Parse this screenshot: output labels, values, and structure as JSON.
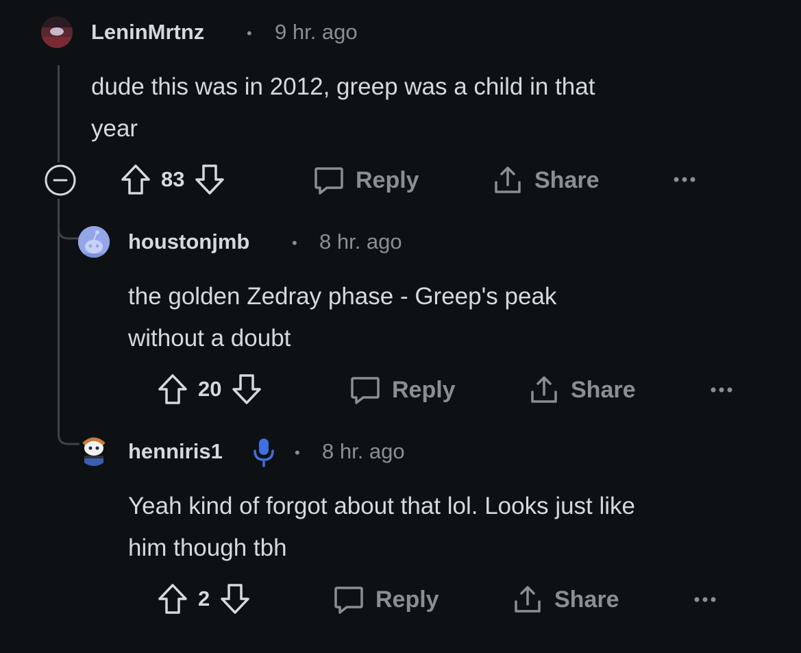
{
  "comments": [
    {
      "username": "LeninMrtnz",
      "time": "9 hr. ago",
      "body_line1": "dude this was in 2012, greep was a child in that",
      "body_line2": "year",
      "votes": "83",
      "reply_label": "Reply",
      "share_label": "Share"
    },
    {
      "username": "houstonjmb",
      "time": "8 hr. ago",
      "body_line1": "the golden Zedray phase - Greep's peak",
      "body_line2": "without a doubt",
      "votes": "20",
      "reply_label": "Reply",
      "share_label": "Share"
    },
    {
      "username": "henniris1",
      "time": "8 hr. ago",
      "body_line1": "Yeah kind of forgot about that lol. Looks just like",
      "body_line2": "him though tbh",
      "votes": "2",
      "reply_label": "Reply",
      "share_label": "Share"
    }
  ],
  "separator": "•",
  "icons": {
    "collapse": "minus-circle-icon",
    "upvote": "arrow-up-icon",
    "downvote": "arrow-down-icon",
    "reply": "speech-bubble-icon",
    "share": "share-icon",
    "more": "ellipsis-icon",
    "flair": "microphone-icon"
  },
  "colors": {
    "background": "#0e1113",
    "text": "#d7dadc",
    "muted": "#8a8f93",
    "thread_line": "#3f4347",
    "flair_blue": "#3f6fe0"
  }
}
